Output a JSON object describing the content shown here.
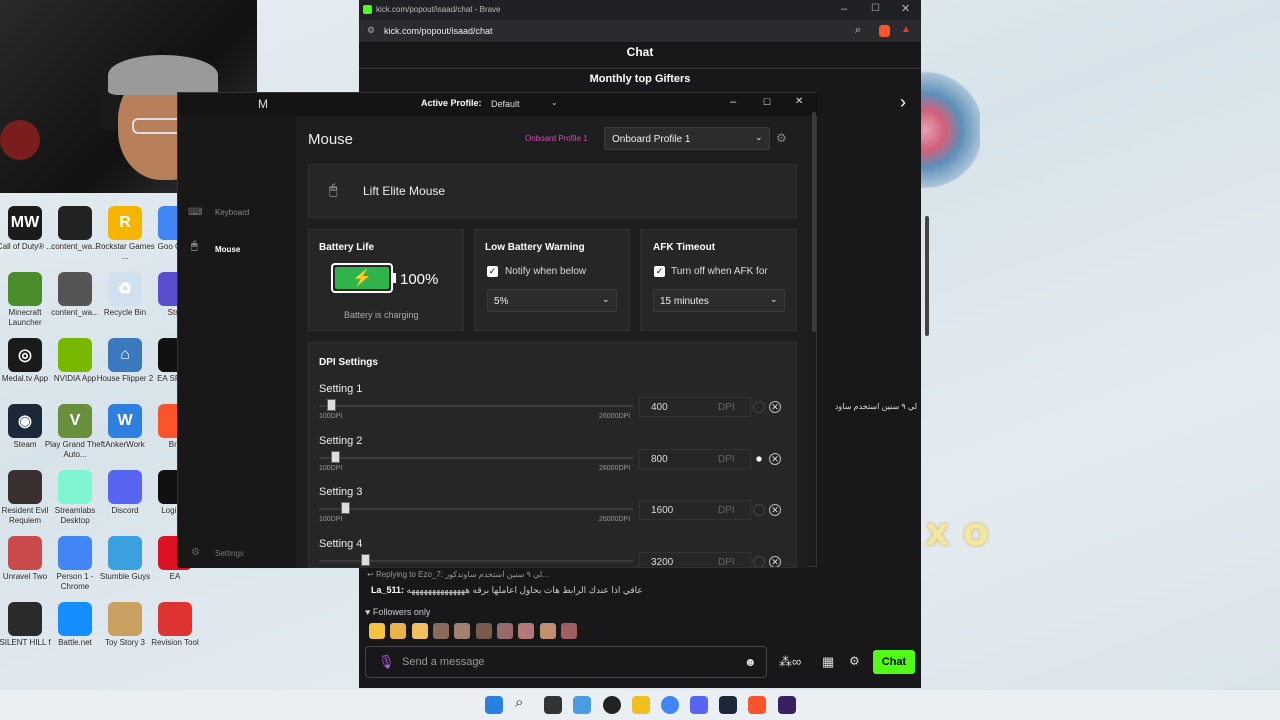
{
  "desktop": {
    "icons": [
      {
        "label": "Call of Duty® ...",
        "color": "#1b1b1b",
        "glyph": "MW"
      },
      {
        "label": "content_wa...",
        "color": "#222",
        "glyph": ""
      },
      {
        "label": "Rockstar Games ...",
        "color": "#f4b400",
        "glyph": "R"
      },
      {
        "label": "Goo Chro",
        "color": "#4285f4",
        "glyph": ""
      },
      {
        "label": "Minecraft Launcher",
        "color": "#4a8d2a",
        "glyph": ""
      },
      {
        "label": "content_wa...",
        "color": "#555",
        "glyph": ""
      },
      {
        "label": "Recycle Bin",
        "color": "#cfe0ef",
        "glyph": "♻"
      },
      {
        "label": "Stre",
        "color": "#5a4fcf",
        "glyph": ""
      },
      {
        "label": "Medal.tv App",
        "color": "#1a1a1a",
        "glyph": "◎"
      },
      {
        "label": "NVIDIA App",
        "color": "#76b900",
        "glyph": ""
      },
      {
        "label": "House Flipper 2",
        "color": "#3a78c0",
        "glyph": "⌂"
      },
      {
        "label": "EA SP FC",
        "color": "#111",
        "glyph": ""
      },
      {
        "label": "Steam",
        "color": "#1b2838",
        "glyph": "◉"
      },
      {
        "label": "Play Grand Theft Auto...",
        "color": "#6a8f3c",
        "glyph": "V"
      },
      {
        "label": "AnkerWork",
        "color": "#2f7fe0",
        "glyph": "W"
      },
      {
        "label": "Bra",
        "color": "#fb542b",
        "glyph": ""
      },
      {
        "label": "Resident Evil Requiem",
        "color": "#3a3030",
        "glyph": ""
      },
      {
        "label": "Streamlabs Desktop",
        "color": "#80f5d2",
        "glyph": ""
      },
      {
        "label": "Discord",
        "color": "#5865f2",
        "glyph": ""
      },
      {
        "label": "Logi Ho",
        "color": "#111",
        "glyph": ""
      },
      {
        "label": "Unravel Two",
        "color": "#c84a4a",
        "glyph": ""
      },
      {
        "label": "Person 1 - Chrome",
        "color": "#4285f4",
        "glyph": ""
      },
      {
        "label": "Stumble Guys",
        "color": "#3aa0e0",
        "glyph": ""
      },
      {
        "label": "EA",
        "color": "#d12",
        "glyph": ""
      },
      {
        "label": "SILENT HILL f",
        "color": "#2a2a2a",
        "glyph": ""
      },
      {
        "label": "Battle.net",
        "color": "#148eff",
        "glyph": ""
      },
      {
        "label": "Toy Story 3",
        "color": "#c8a060",
        "glyph": ""
      },
      {
        "label": "Revision Tool",
        "color": "#d33",
        "glyph": ""
      }
    ]
  },
  "browser": {
    "window_title": "kick.com/popout/isaad/chat - Brave",
    "url": "kick.com/popout/isaad/chat",
    "chat_title": "Chat",
    "top_gifters": "Monthly top Gifters",
    "arabic_line": "لي ٩ سنين استخدم ساود",
    "reply_to": "Replying to Ezo_7: لي ٩ سنين استخدم ساوندكور...",
    "message_user": "La_511:",
    "message_text": "عافي اذا عندك الرابط هات بحاول اعاملها برقه ههههههههههههههه",
    "followers_only": "Followers only",
    "input_placeholder": "Send a message",
    "chat_button": "Chat"
  },
  "ghub": {
    "active_profile_label": "Active Profile:",
    "active_profile_value": "Default",
    "sidebar": {
      "keyboard": "Keyboard",
      "mouse": "Mouse",
      "settings": "Settings"
    },
    "page_title": "Mouse",
    "onboard_label": "Onboard Profile 1",
    "onboard_select": "Onboard Profile 1",
    "device_name": "Lift Elite Mouse",
    "battery": {
      "title": "Battery Life",
      "percent": "100%",
      "percent_value": 100,
      "status": "Battery is charging"
    },
    "low_battery": {
      "title": "Low Battery Warning",
      "checkbox": "Notify when below",
      "value": "5%"
    },
    "afk": {
      "title": "AFK Timeout",
      "checkbox": "Turn off when AFK for",
      "value": "15 minutes"
    },
    "dpi": {
      "title": "DPI Settings",
      "min_label": "100DPI",
      "max_label": "26000DPI",
      "unit": "DPI",
      "settings": [
        {
          "label": "Setting 1",
          "value": "400",
          "dpi": 400,
          "active": false
        },
        {
          "label": "Setting 2",
          "value": "800",
          "dpi": 800,
          "active": true
        },
        {
          "label": "Setting 3",
          "value": "1600",
          "dpi": 1600,
          "active": false
        },
        {
          "label": "Setting 4",
          "value": "3200",
          "dpi": 3200,
          "active": false
        }
      ]
    }
  },
  "colors": {
    "kick_green": "#53fc18",
    "battery_green": "#2fb34a",
    "onboard_pink": "#d04ab8"
  }
}
